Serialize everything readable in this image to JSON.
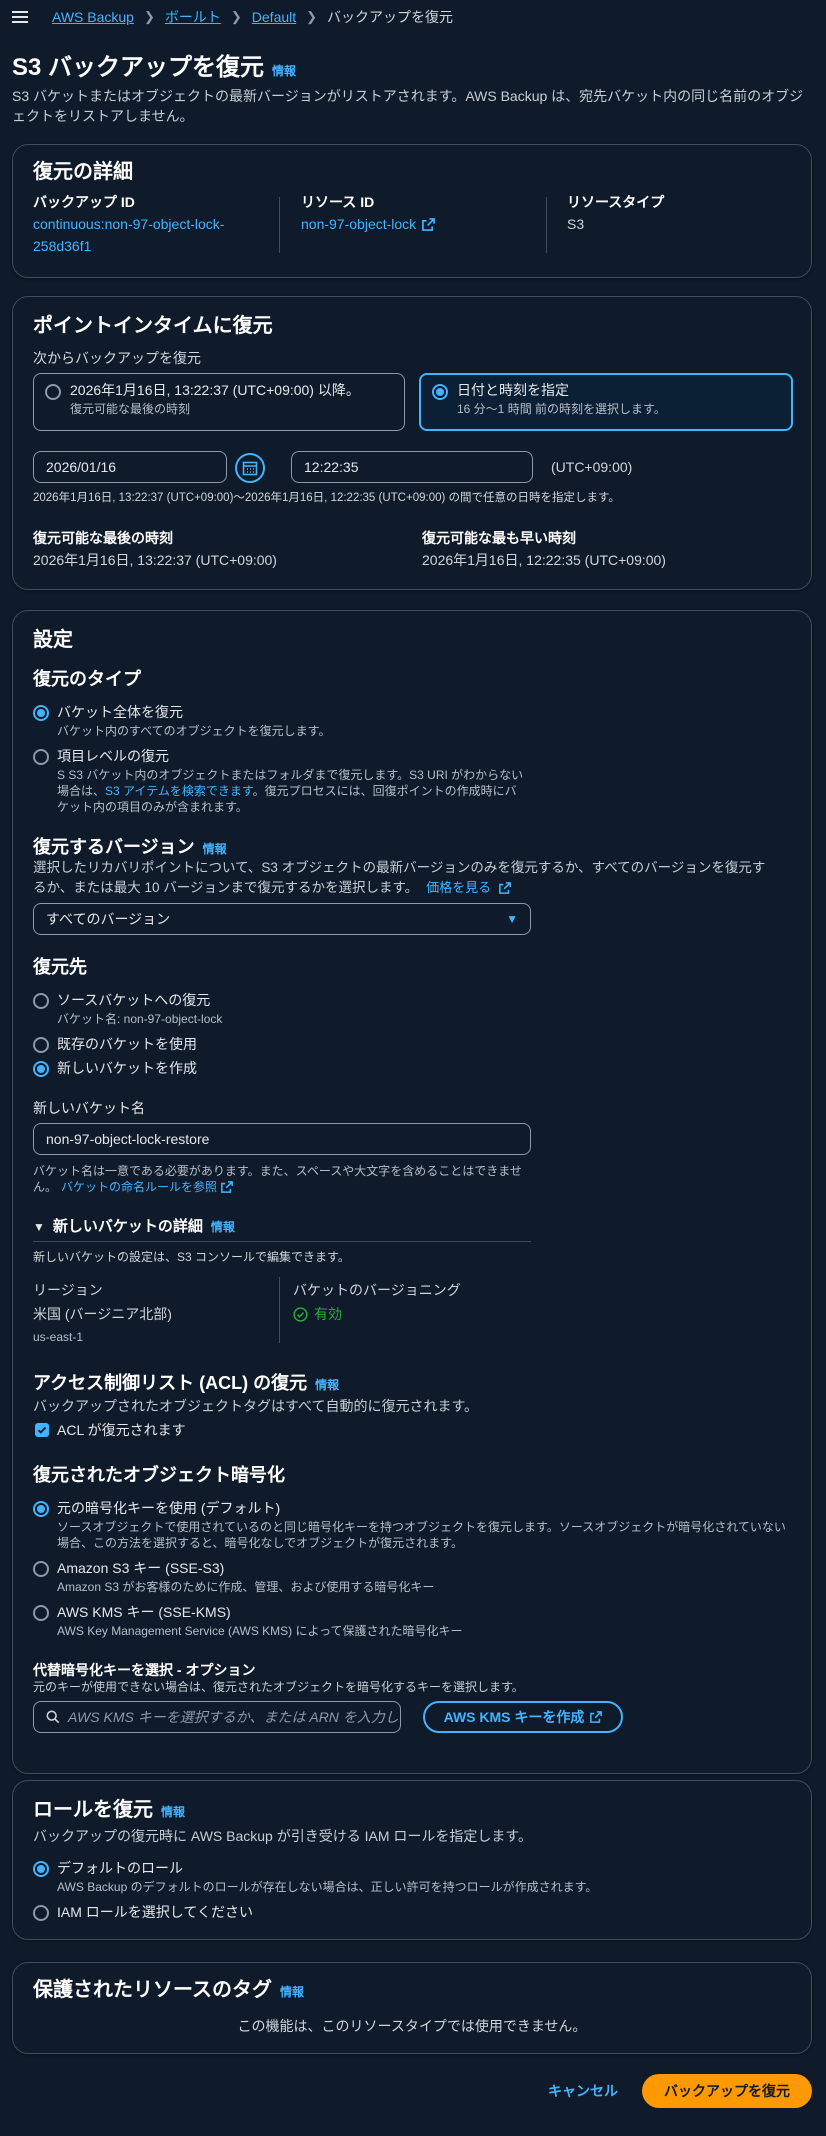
{
  "breadcrumb": {
    "items": [
      "AWS Backup",
      "ボールト",
      "Default"
    ],
    "current": "バックアップを復元"
  },
  "page": {
    "title": "S3 バックアップを復元",
    "info": "情報",
    "description": "S3 バケットまたはオブジェクトの最新バージョンがリストアされます。AWS Backup は、宛先バケット内の同じ名前のオブジェクトをリストアしません。"
  },
  "restore_details": {
    "heading": "復元の詳細",
    "backup_id_label": "バックアップ ID",
    "backup_id_line1": "continuous:non-97-object-lock-",
    "backup_id_line2": "258d36f1",
    "resource_id_label": "リソース ID",
    "resource_id": "non-97-object-lock",
    "resource_type_label": "リソースタイプ",
    "resource_type": "S3"
  },
  "pitr": {
    "heading": "ポイントインタイムに復元",
    "restore_from_label": "次からバックアップを復元",
    "option1_title": "2026年1月16日, 13:22:37 (UTC+09:00) 以降。",
    "option1_desc": "復元可能な最後の時刻",
    "option2_title": "日付と時刻を指定",
    "option2_desc": "16 分〜1 時間 前の時刻を選択します。",
    "date_value": "2026/01/16",
    "time_value": "12:22:35",
    "timezone": "(UTC+09:00)",
    "range_hint": "2026年1月16日, 13:22:37 (UTC+09:00)〜2026年1月16日, 12:22:35 (UTC+09:00) の間で任意の日時を指定します。",
    "latest_label": "復元可能な最後の時刻",
    "latest_value": "2026年1月16日, 13:22:37 (UTC+09:00)",
    "earliest_label": "復元可能な最も早い時刻",
    "earliest_value": "2026年1月16日, 12:22:35 (UTC+09:00)"
  },
  "settings": {
    "heading": "設定",
    "restore_type_heading": "復元のタイプ",
    "rt_option1_title": "バケット全体を復元",
    "rt_option1_desc": "バケット内のすべてのオブジェクトを復元します。",
    "rt_option2_title": "項目レベルの復元",
    "rt_option2_desc_a": "S S3 バケット内のオブジェクトまたはフォルダまで復元します。S3 URI がわからない",
    "rt_option2_desc_b1": "場合は、",
    "rt_option2_desc_link": "S3 アイテムを検索できます",
    "rt_option2_desc_b2": "。復元プロセスには、回復ポイントの作成時にバ",
    "rt_option2_desc_c": "ケット内の項目のみが含まれます。",
    "versions_heading": "復元するバージョン",
    "versions_info": "情報",
    "versions_desc_a": "選択したリカバリポイントについて、S3 オブジェクトの最新バージョンのみを復元するか、すべてのバージョンを復元す",
    "versions_desc_b": "るか、または最大 10 バージョンまで復元するかを選択します。",
    "versions_price_link": "価格を見る",
    "versions_select": "すべてのバージョン",
    "destination_heading": "復元先",
    "dest_option1_title": "ソースバケットへの復元",
    "dest_option1_desc": "バケット名: non-97-object-lock",
    "dest_option2_title": "既存のバケットを使用",
    "dest_option3_title": "新しいバケットを作成",
    "new_bucket_label": "新しいバケット名",
    "new_bucket_value": "non-97-object-lock-restore",
    "new_bucket_hint_a": "バケット名は一意である必要があります。また、スペースや大文字を含めることはできませ",
    "new_bucket_hint_b": "ん。",
    "new_bucket_rules_link": "バケットの命名ルールを参照",
    "details_expander": "新しいバケットの詳細",
    "details_info": "情報",
    "details_desc": "新しいバケットの設定は、S3 コンソールで編集できます。",
    "region_label": "リージョン",
    "region_value": "米国 (バージニア北部)",
    "region_code": "us-east-1",
    "versioning_label": "バケットのバージョニング",
    "versioning_value": "有効",
    "acl_heading": "アクセス制御リスト (ACL) の復元",
    "acl_info": "情報",
    "acl_desc": "バックアップされたオブジェクトタグはすべて自動的に復元されます。",
    "acl_checkbox": "ACL が復元されます",
    "enc_heading": "復元されたオブジェクト暗号化",
    "enc_option1_title": "元の暗号化キーを使用 (デフォルト)",
    "enc_option1_desc_a": "ソースオブジェクトで使用されているのと同じ暗号化キーを持つオブジェクトを復元します。ソースオブジェクトが暗号化されていない",
    "enc_option1_desc_b": "場合、この方法を選択すると、暗号化なしでオブジェクトが復元されます。",
    "enc_option2_title": "Amazon S3 キー (SSE-S3)",
    "enc_option2_desc": "Amazon S3 がお客様のために作成、管理、および使用する暗号化キー",
    "enc_option3_title": "AWS KMS キー (SSE-KMS)",
    "enc_option3_desc": "AWS Key Management Service (AWS KMS) によって保護された暗号化キー",
    "alt_key_label": "代替暗号化キーを選択 - オプション",
    "alt_key_desc": "元のキーが使用できない場合は、復元されたオブジェクトを暗号化するキーを選択します。",
    "alt_key_placeholder": "AWS KMS キーを選択するか、または ARN を入力し",
    "create_kms_button": "AWS KMS キーを作成"
  },
  "role": {
    "heading": "ロールを復元",
    "info": "情報",
    "desc": "バックアップの復元時に AWS Backup が引き受ける IAM ロールを指定します。",
    "option1_title": "デフォルトのロール",
    "option1_desc": "AWS Backup のデフォルトのロールが存在しない場合は、正しい許可を持つロールが作成されます。",
    "option2_title": "IAM ロールを選択してください"
  },
  "tags": {
    "heading": "保護されたリソースのタグ",
    "info": "情報",
    "message": "この機能は、このリソースタイプでは使用できません。"
  },
  "footer": {
    "cancel": "キャンセル",
    "restore": "バックアップを復元"
  }
}
